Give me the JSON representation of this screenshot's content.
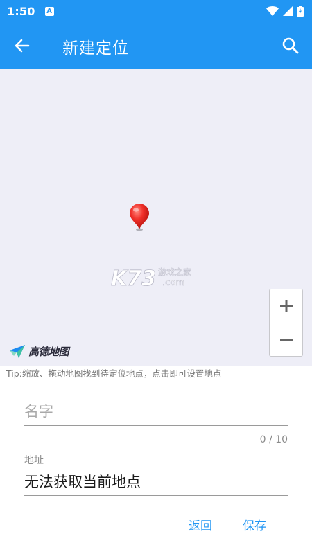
{
  "status_bar": {
    "time": "1:50",
    "notification_icon": "A"
  },
  "toolbar": {
    "title": "新建定位",
    "back_icon": "arrow-left-icon",
    "search_icon": "search-icon"
  },
  "map": {
    "watermark_main": "K73",
    "watermark_sub_top": "游戏之家",
    "watermark_sub_bottom": ".com",
    "provider_name": "高德地图",
    "zoom_in_label": "+",
    "zoom_out_label": "−",
    "pin_icon": "map-pin-icon"
  },
  "tip": "Tip:缩放、拖动地图找到待定位地点，点击即可设置地点",
  "form": {
    "name_placeholder": "名字",
    "name_value": "",
    "name_counter": "0 / 10",
    "address_label": "地址",
    "address_value": "无法获取当前地点"
  },
  "actions": {
    "back_label": "返回",
    "save_label": "保存"
  },
  "colors": {
    "primary": "#2196F3",
    "map_background": "#eeeef7",
    "pin": "#f0302a"
  }
}
